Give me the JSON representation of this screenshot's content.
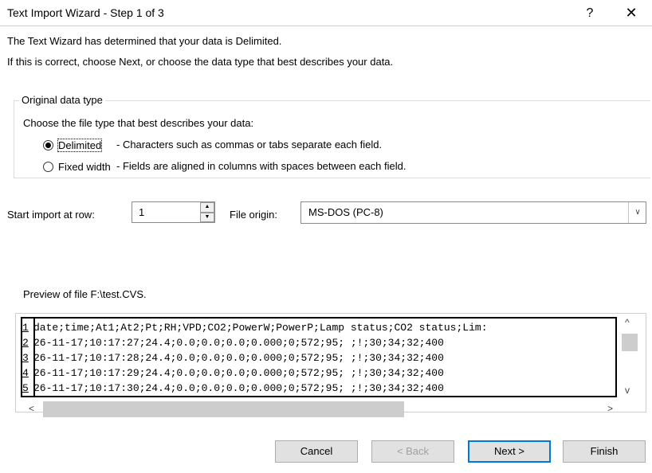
{
  "window": {
    "title": "Text Import Wizard - Step 1 of 3",
    "help_label": "?",
    "close_label": "✕"
  },
  "intro": {
    "line1": "The Text Wizard has determined that your data is Delimited.",
    "line2": "If this is correct, choose Next, or choose the data type that best describes your data."
  },
  "data_type_group": {
    "legend": "Original data type",
    "prompt": "Choose the file type that best describes your data:",
    "options": [
      {
        "label": "Delimited",
        "description": "- Characters such as commas or tabs separate each field.",
        "selected": true
      },
      {
        "label": "Fixed width",
        "description": "- Fields are aligned in columns with spaces between each field.",
        "selected": false
      }
    ]
  },
  "start_row": {
    "label": "Start import at row:",
    "value": "1"
  },
  "file_origin": {
    "label": "File origin:",
    "value": "MS-DOS (PC-8)"
  },
  "preview": {
    "label": "Preview of file F:\\test.CVS.",
    "rows": [
      {
        "num": "1",
        "text": "date;time;At1;At2;Pt;RH;VPD;CO2;PowerW;PowerP;Lamp status;CO2 status;Lim:"
      },
      {
        "num": "2",
        "text": "26-11-17;10:17:27;24.4;0.0;0.0;0.0;0.000;0;572;95; ;!;30;34;32;400"
      },
      {
        "num": "3",
        "text": "26-11-17;10:17:28;24.4;0.0;0.0;0.0;0.000;0;572;95; ;!;30;34;32;400"
      },
      {
        "num": "4",
        "text": "26-11-17;10:17:29;24.4;0.0;0.0;0.0;0.000;0;572;95; ;!;30;34;32;400"
      },
      {
        "num": "5",
        "text": "26-11-17;10:17:30;24.4;0.0;0.0;0.0;0.000;0;572;95; ;!;30;34;32;400"
      }
    ]
  },
  "buttons": {
    "cancel": "Cancel",
    "back": "< Back",
    "next": "Next >",
    "finish": "Finish"
  },
  "icons": {
    "scroll_up": "^",
    "scroll_down": "v",
    "scroll_left": "<",
    "scroll_right": ">",
    "spin_up": "▲",
    "spin_down": "▼",
    "dropdown": "∨"
  }
}
